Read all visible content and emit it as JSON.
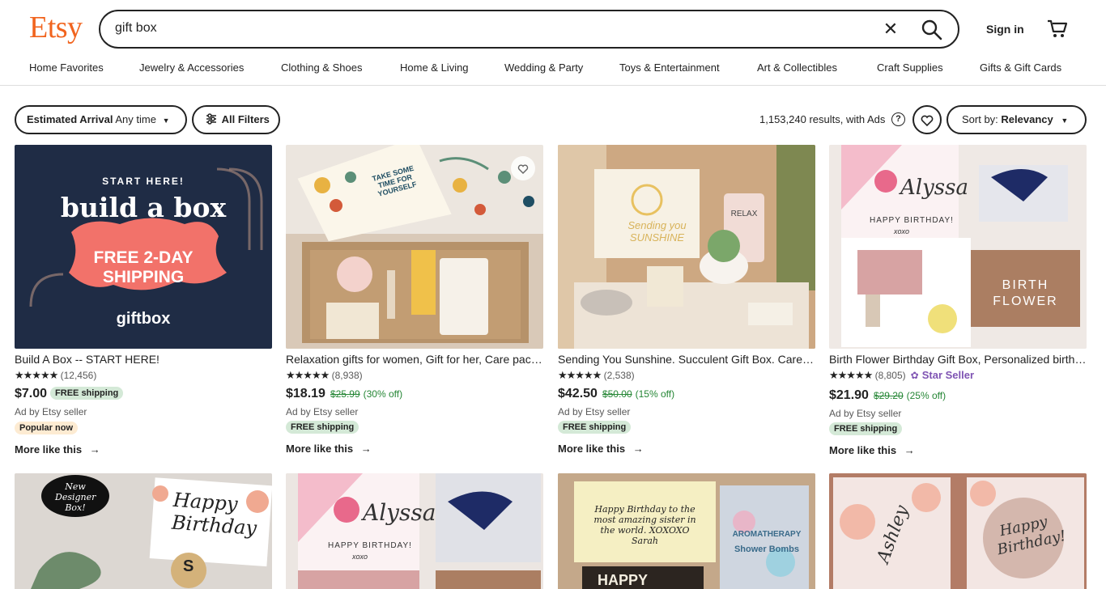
{
  "header": {
    "logo": "Etsy",
    "search_value": "gift box",
    "signin_label": "Sign in"
  },
  "nav": [
    "Home Favorites",
    "Jewelry & Accessories",
    "Clothing & Shoes",
    "Home & Living",
    "Wedding & Party",
    "Toys & Entertainment",
    "Art & Collectibles",
    "Craft Supplies",
    "Gifts & Gift Cards"
  ],
  "filters": {
    "arrival_label": "Estimated Arrival",
    "arrival_value": "Any time",
    "all_filters": "All Filters",
    "results": "1,153,240 results, with Ads",
    "sort_label": "Sort by:",
    "sort_value": "Relevancy"
  },
  "products": [
    {
      "title": "Build A Box -- START HERE!",
      "rating_count": "(12,456)",
      "price": "$7.00",
      "badge": "FREE shipping",
      "ad": "Ad by Etsy seller",
      "tag": "Popular now",
      "more": "More like this",
      "img_line1": "START HERE!",
      "img_line2": "build a box",
      "img_line3": "FREE 2-DAY",
      "img_line4": "SHIPPING",
      "img_brand": "giftbox"
    },
    {
      "title": "Relaxation gifts for women, Gift for her, Care package, Self care gift box, Spa gift",
      "rating_count": "(8,938)",
      "price": "$18.19",
      "orig": "$25.99",
      "disc": "(30% off)",
      "ad": "Ad by Etsy seller",
      "badge": "FREE shipping",
      "more": "More like this",
      "img_text": "TAKE SOME TIME FOR YOURSELF"
    },
    {
      "title": "Sending You Sunshine. Succulent Gift Box. Care Package",
      "rating_count": "(2,538)",
      "price": "$42.50",
      "orig": "$50.00",
      "disc": "(15% off)",
      "ad": "Ad by Etsy seller",
      "badge": "FREE shipping",
      "more": "More like this",
      "img_text": "Sending you SUNSHINE",
      "img_text2": "RELAX"
    },
    {
      "title": "Birth Flower Birthday Gift Box, Personalized birthday gift",
      "rating_count": "(8,805)",
      "star_seller": "Star Seller",
      "price": "$21.90",
      "orig": "$29.20",
      "disc": "(25% off)",
      "ad": "Ad by Etsy seller",
      "badge": "FREE shipping",
      "more": "More like this",
      "img_name": "Alyssa",
      "img_bday": "HAPPY BIRTHDAY!",
      "img_xoxo": "xoxo",
      "img_birth": "BIRTH",
      "img_flower": "FLOWER"
    }
  ],
  "row2": {
    "c1_badge": "New Designer Box!",
    "c1_text": "Happy Birthday",
    "c1_letter": "S",
    "c2_name": "Alyssa",
    "c2_bday": "HAPPY BIRTHDAY!",
    "c2_xoxo": "xoxo",
    "c3_card": "Happy Birthday to the most amazing sister in the world. XOXOXO Sarah",
    "c3_bag1": "AROMATHERAPY",
    "c3_bag2": "Shower Bombs",
    "c3_happy": "HAPPY",
    "c4_name": "Ashley",
    "c4_bday": "Happy Birthday!"
  },
  "colors": {
    "brand": "#F1641E",
    "sale_green": "#258635",
    "badge_green": "#D4E9D7",
    "star_seller": "#7F54B3"
  }
}
